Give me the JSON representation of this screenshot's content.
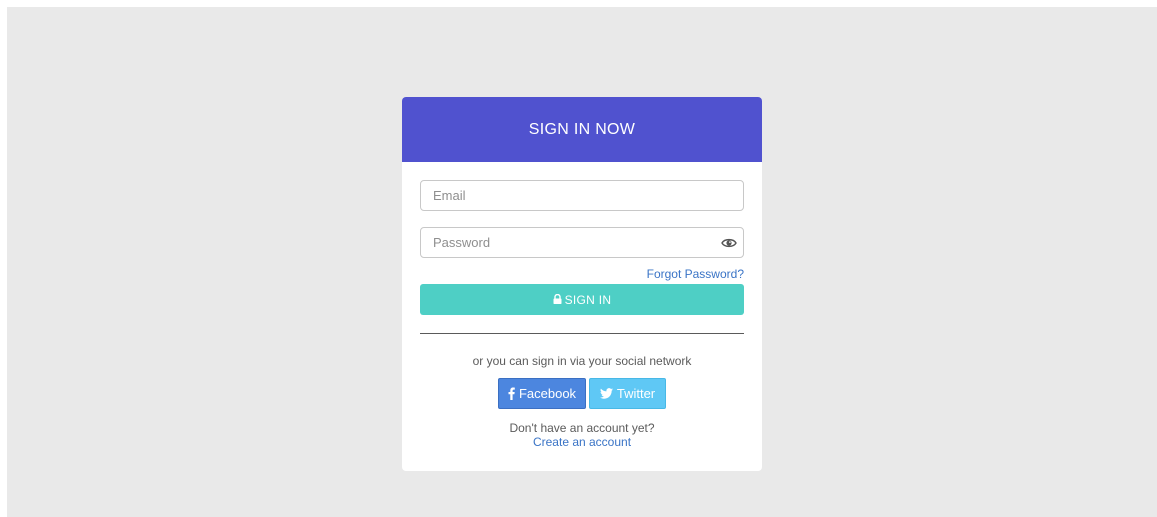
{
  "header": {
    "title": "SIGN IN NOW"
  },
  "form": {
    "email_placeholder": "Email",
    "email_value": "",
    "password_placeholder": "Password",
    "password_value": "",
    "forgot_label": "Forgot Password?",
    "signin_label": "SIGN IN"
  },
  "social": {
    "prompt": "or you can sign in via your social network",
    "facebook_label": "Facebook",
    "twitter_label": "Twitter"
  },
  "footer": {
    "question": "Don't have an account yet?",
    "create_label": "Create an account"
  },
  "icons": {
    "password_toggle": "eye-icon",
    "signin": "lock-icon",
    "facebook": "facebook-icon",
    "twitter": "twitter-icon"
  },
  "colors": {
    "page_background": "#e9e9e9",
    "header_background": "#5052cf",
    "signin_button": "#4ecfc5",
    "facebook_button": "#4c86df",
    "twitter_button": "#5fc8f5",
    "link": "#3a74c6"
  }
}
